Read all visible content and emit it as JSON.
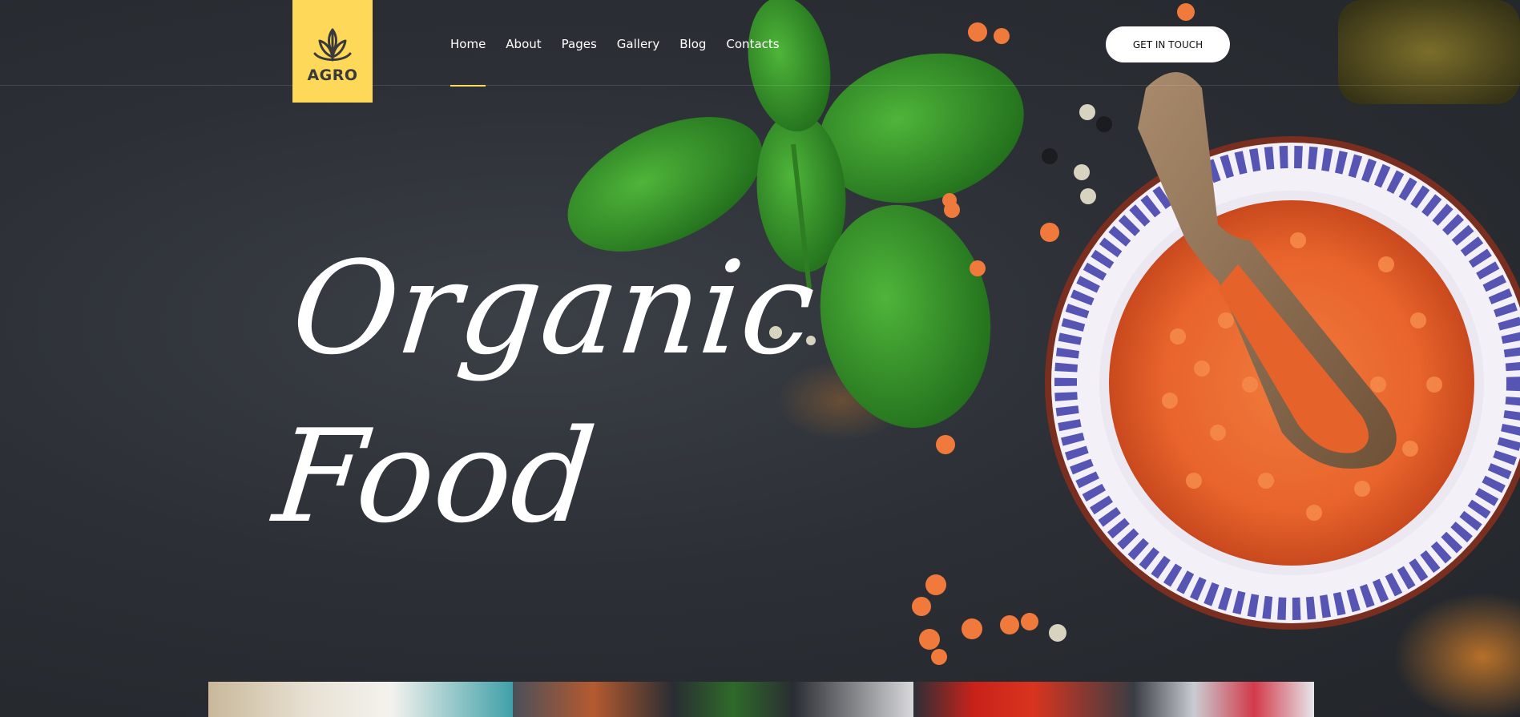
{
  "brand": {
    "logo_text": "AGRO",
    "logo_icon": "sprout-icon",
    "accent_color": "#fed858"
  },
  "nav": {
    "items": [
      {
        "label": "Home",
        "active": true
      },
      {
        "label": "About",
        "active": false
      },
      {
        "label": "Pages",
        "active": false
      },
      {
        "label": "Gallery",
        "active": false
      },
      {
        "label": "Blog",
        "active": false
      },
      {
        "label": "Contacts",
        "active": false
      }
    ]
  },
  "header": {
    "cta_label": "GET IN TOUCH"
  },
  "hero": {
    "line1": "Organic",
    "line2": "Food"
  },
  "thumbnails": [
    {
      "name": "oats-milk-thumbnail"
    },
    {
      "name": "salad-bowl-thumbnail"
    },
    {
      "name": "tomatoes-fork-thumbnail"
    }
  ]
}
